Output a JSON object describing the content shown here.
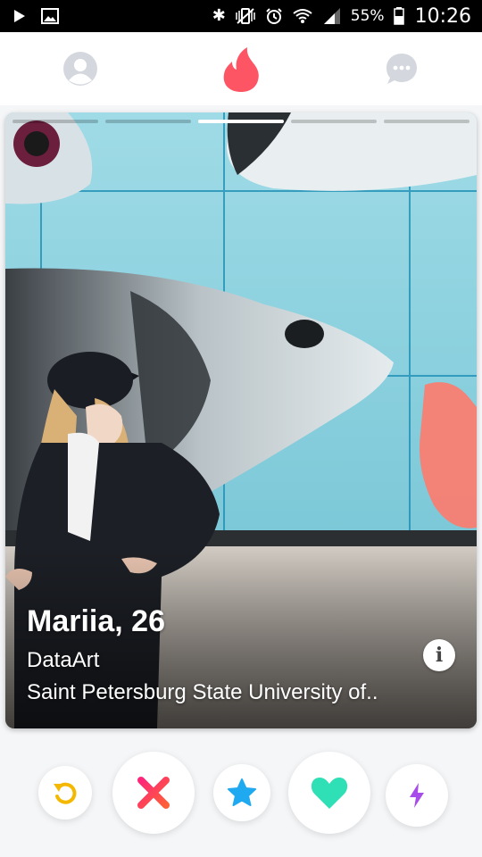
{
  "status_bar": {
    "battery_percent": "55%",
    "time": "10:26",
    "icons": [
      "play-icon",
      "image-icon",
      "bluetooth-icon",
      "vibrate-mute-icon",
      "alarm-icon",
      "wifi-icon",
      "signal-icon",
      "battery-icon"
    ]
  },
  "top_nav": {
    "icons": [
      "profile-icon",
      "flame-icon",
      "chat-icon"
    ],
    "colors": {
      "inactive": "#d4d8de",
      "flame": "#fd5564"
    }
  },
  "card": {
    "photo_count": 5,
    "active_photo_index": 2,
    "name": "Mariia",
    "separator": ", ",
    "age": "26",
    "line1": "DataArt",
    "line2": "Saint Petersburg State University of..",
    "info_button": "i"
  },
  "actions": {
    "buttons": [
      "rewind-button",
      "nope-button",
      "super-like-button",
      "like-button",
      "boost-button"
    ],
    "colors": {
      "rewind": "#f5b800",
      "nope": "#fd4c68",
      "super_like": "#1fa9f0",
      "like": "#2fdfb5",
      "boost": "#a74bea"
    }
  }
}
